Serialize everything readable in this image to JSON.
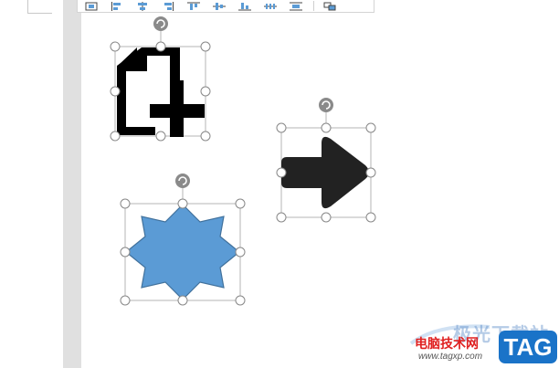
{
  "toolbar": {
    "buttons": [
      {
        "name": "wrap-text",
        "icon": "wrap-icon"
      },
      {
        "name": "align-left",
        "icon": "align-left-icon"
      },
      {
        "name": "align-center",
        "icon": "align-center-icon"
      },
      {
        "name": "align-right",
        "icon": "align-right-icon"
      },
      {
        "name": "align-top",
        "icon": "align-top-icon"
      },
      {
        "name": "align-middle",
        "icon": "align-middle-icon"
      },
      {
        "name": "align-bottom",
        "icon": "align-bottom-icon"
      },
      {
        "name": "distribute-horizontal",
        "icon": "distribute-horizontal-icon"
      },
      {
        "name": "distribute-vertical",
        "icon": "distribute-vertical-icon"
      },
      {
        "name": "group",
        "icon": "group-icon"
      }
    ]
  },
  "shapes": [
    {
      "name": "new-file-shape",
      "icon": "file-plus-icon",
      "fill": "#000000",
      "selected": true
    },
    {
      "name": "right-arrow-shape",
      "icon": "arrow-right-icon",
      "fill": "#222222",
      "selected": true
    },
    {
      "name": "eight-point-star-shape",
      "icon": "star-8-icon",
      "fill": "#5b9bd5",
      "stroke": "#41719c",
      "selected": true
    }
  ],
  "selection": {
    "handle_color": "#888888",
    "rotate_handle_color": "#777777"
  },
  "watermark": {
    "title": "极光下载站",
    "cn_text": "电脑技术网",
    "url": "www.tagxp.com",
    "tag": "TAG",
    "tag_color": "#1a73c8",
    "cn_color": "#e02020"
  }
}
